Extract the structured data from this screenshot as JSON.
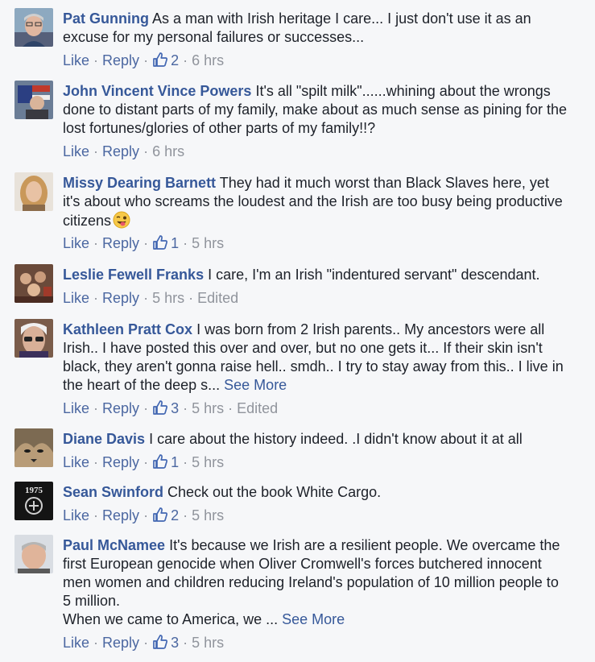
{
  "colors": {
    "background": "#f6f7f9",
    "link": "#365899",
    "meta": "#90949c",
    "text": "#1d2129"
  },
  "labels": {
    "like": "Like",
    "reply": "Reply",
    "see_more": "See More",
    "edited": "Edited"
  },
  "comments": [
    {
      "author": "Pat Gunning",
      "lines": [
        "As a man with Irish heritage I care... I just don't use it as an",
        "excuse for my personal failures or successes..."
      ],
      "likes": "2",
      "time": "6 hrs"
    },
    {
      "author": "John Vincent Vince Powers",
      "lines": [
        "It's all \"spilt milk\"......whining about the wrongs",
        "done to distant parts of my family, make about as much sense as pining for the",
        "lost fortunes/glories of other parts of my family!!?"
      ],
      "time": "6 hrs"
    },
    {
      "author": "Missy Dearing Barnett",
      "lines": [
        "They had it much worst than Black Slaves here, yet",
        "it's about who screams the loudest and the Irish are too busy being productive",
        "citizens"
      ],
      "likes": "1",
      "time": "5 hrs",
      "emoji": "winking-tongue-emoji"
    },
    {
      "author": "Leslie Fewell Franks",
      "lines": [
        "I care, I'm an Irish \"indentured servant\" descendant."
      ],
      "time": "5 hrs",
      "edited": true
    },
    {
      "author": "Kathleen Pratt Cox",
      "lines": [
        "I was born from 2 Irish parents.. My ancestors were all",
        "Irish.. I have posted this over and over, but no one gets it... If their skin isn't",
        "black, they aren't gonna raise hell.. smdh.. I try to stay away from this.. I live in",
        "the heart of the deep s..."
      ],
      "see_more": true,
      "likes": "3",
      "time": "5 hrs",
      "edited": true
    },
    {
      "author": "Diane Davis",
      "lines": [
        "I care about the history indeed. .I didn't know about it at all"
      ],
      "likes": "1",
      "time": "5 hrs"
    },
    {
      "author": "Sean Swinford",
      "lines": [
        "Check out the book White Cargo."
      ],
      "likes": "2",
      "time": "5 hrs",
      "avatar_text": "1975"
    },
    {
      "author": "Paul McNamee",
      "lines": [
        "It's because we Irish are a resilient people. We overcame the",
        "first European genocide when Oliver Cromwell's forces butchered innocent",
        "men women and children reducing Ireland's population of 10 million people to",
        "5 million.",
        "When we came to America, we ..."
      ],
      "see_more": true,
      "likes": "3",
      "time": "5 hrs"
    }
  ]
}
